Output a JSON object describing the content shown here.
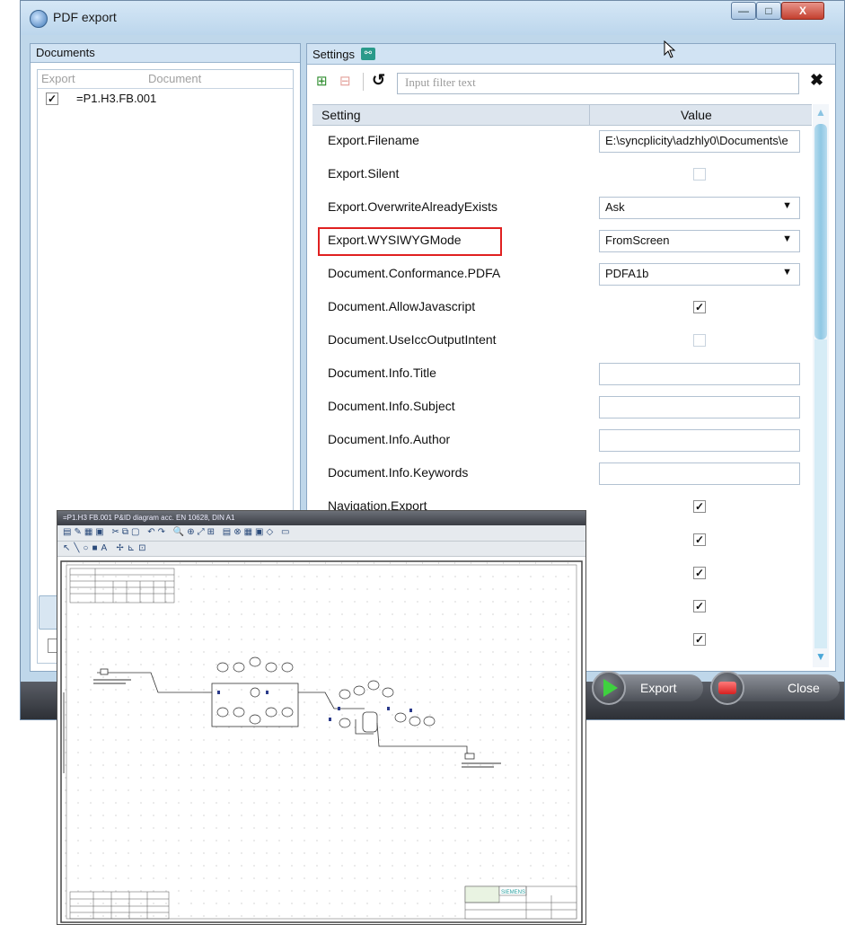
{
  "window": {
    "title": "PDF export",
    "caption_buttons": {
      "minimize": "—",
      "maximize": "□",
      "close": "X"
    }
  },
  "documents": {
    "header": "Documents",
    "columns": {
      "export": "Export",
      "document": "Document"
    },
    "rows": [
      {
        "checked": "✓",
        "name": "=P1.H3.FB.001"
      }
    ]
  },
  "settings": {
    "header": "Settings",
    "filter_placeholder": "Input filter text",
    "columns": {
      "setting": "Setting",
      "value": "Value"
    },
    "rows": [
      {
        "label": "Export.Filename",
        "value": "E:\\syncplicity\\adzhly0\\Documents\\e"
      },
      {
        "label": "Export.Silent",
        "checked": false
      },
      {
        "label": "Export.OverwriteAlreadyExists",
        "value": "Ask"
      },
      {
        "label": "Export.WYSIWYGMode",
        "value": "FromScreen"
      },
      {
        "label": "Document.Conformance.PDFA",
        "value": "PDFA1b"
      },
      {
        "label": "Document.AllowJavascript",
        "checked": true
      },
      {
        "label": "Document.UseIccOutputIntent",
        "checked": false
      },
      {
        "label": "Document.Info.Title",
        "value": ""
      },
      {
        "label": "Document.Info.Subject",
        "value": ""
      },
      {
        "label": "Document.Info.Author",
        "value": ""
      },
      {
        "label": "Document.Info.Keywords",
        "value": ""
      },
      {
        "label": "Navigation.Export",
        "checked": true
      },
      {
        "label": "",
        "checked": true
      },
      {
        "label": "",
        "checked": true
      },
      {
        "label": "",
        "checked": true
      },
      {
        "label": "",
        "checked": true
      }
    ],
    "check_glyph": "✓",
    "dropdown_arrow": "▼"
  },
  "buttons": {
    "export": "Export",
    "close": "Close"
  },
  "editor": {
    "tab": "=P1.H3   FB.001  P&ID diagram acc. EN 10628, DIN A1",
    "toolbar1": "▤✎▦▣ ✂⧉▢ ↶↷ 🔍⊕⤢⊞ ▤⊗▦▣◇ ▭",
    "toolbar2": "↖╲○■A ✢⊾⊡",
    "title_block_brand": "SIEMENS"
  },
  "colors": {
    "window_frame": "#bfd7ea",
    "panel_header": "#d1e3f3",
    "highlight_box": "#e02020",
    "scrollbar_thumb": "#8fc8e4",
    "export_icon": "#3fd13f",
    "close_icon": "#d62020"
  },
  "icons": [
    "app-icon",
    "add-icon",
    "remove-icon",
    "reset-icon",
    "clear-filter-icon",
    "play-icon",
    "stop-icon",
    "cursor-icon"
  ]
}
